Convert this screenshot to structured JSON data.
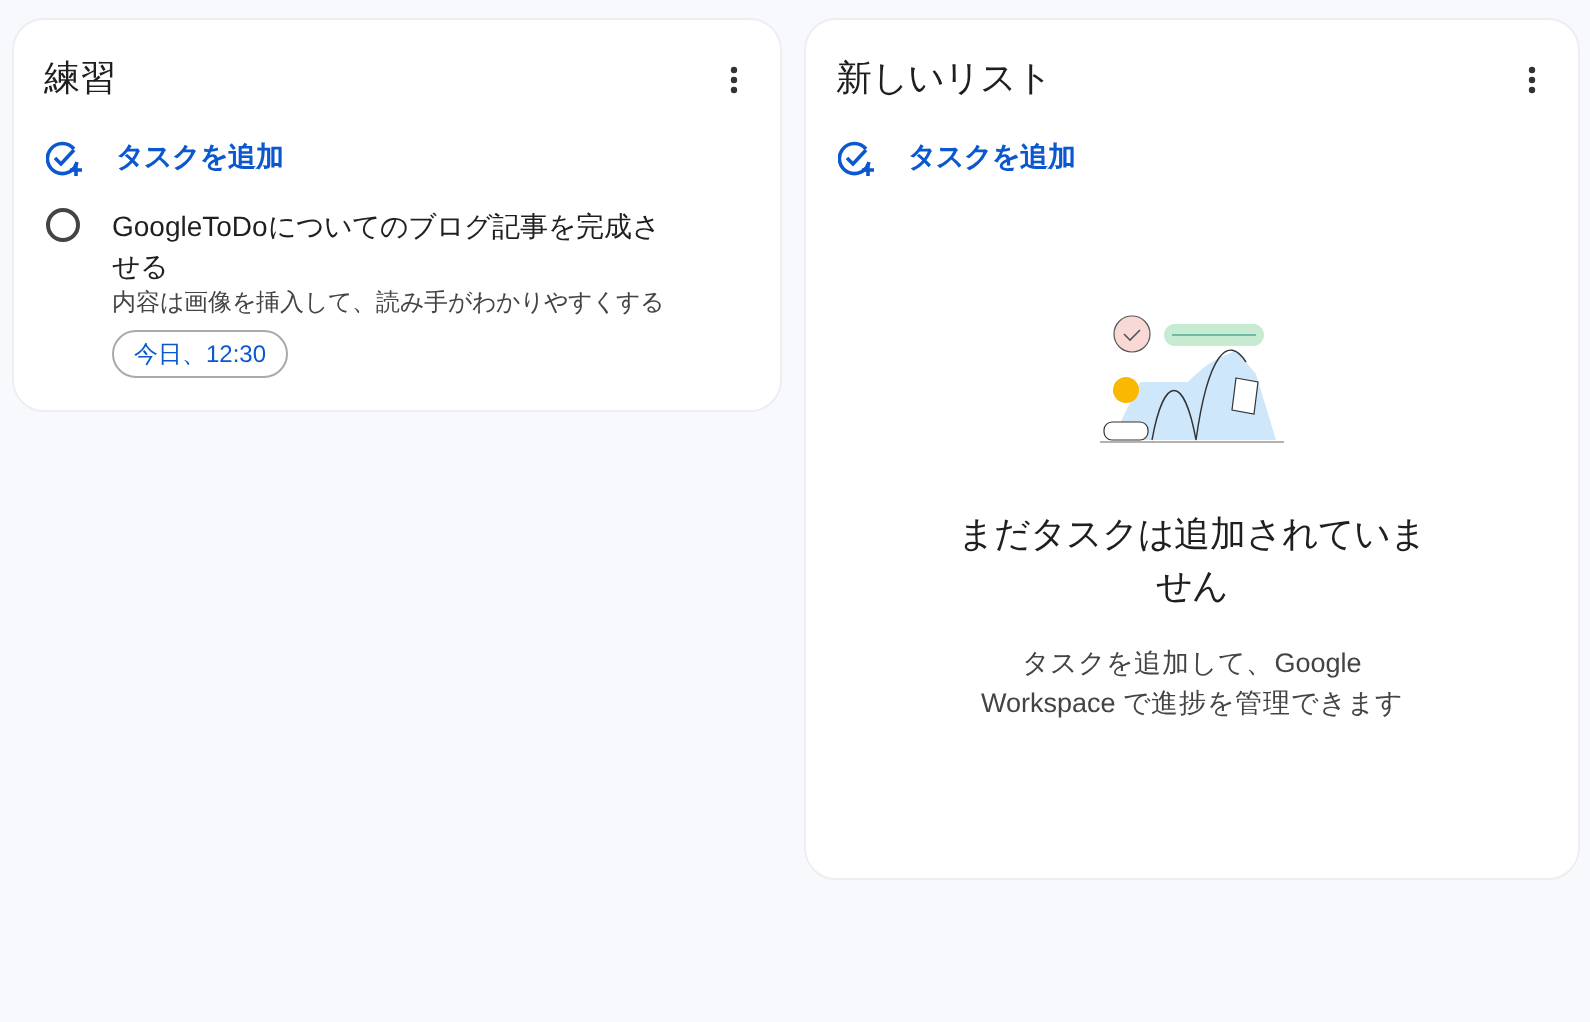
{
  "lists": [
    {
      "title": "練習",
      "add_task_label": "タスクを追加",
      "tasks": [
        {
          "title": "GoogleToDoについてのブログ記事を完成させる",
          "notes": "内容は画像を挿入して、読み手がわかりやすくする",
          "due": "今日、12:30",
          "completed": false
        }
      ]
    },
    {
      "title": "新しいリスト",
      "add_task_label": "タスクを追加",
      "empty_state": {
        "heading": "まだタスクは追加されていません",
        "body": "タスクを追加して、Google Workspace で進捗を管理できます"
      }
    }
  ]
}
